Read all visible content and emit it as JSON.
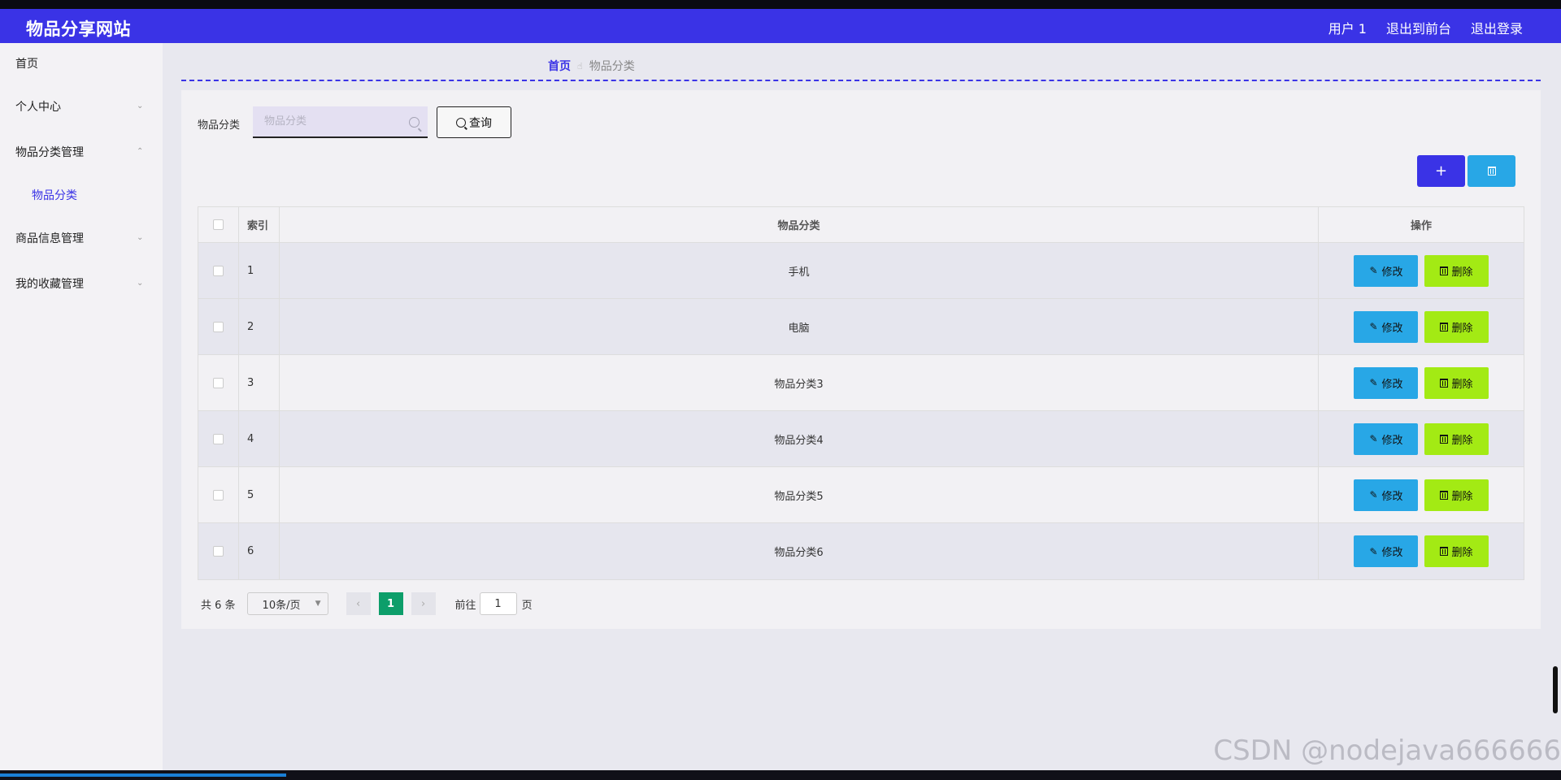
{
  "header": {
    "site_title": "物品分享网站",
    "user": "用户 1",
    "to_front": "退出到前台",
    "logout": "退出登录"
  },
  "sidebar": {
    "items": [
      {
        "label": "首页",
        "chevron": ""
      },
      {
        "label": "个人中心",
        "chevron": "chevron-down-icon"
      },
      {
        "label": "物品分类管理",
        "chevron": "chevron-up-icon"
      },
      {
        "label": "物品分类",
        "chevron": ""
      },
      {
        "label": "商品信息管理",
        "chevron": "chevron-down-icon"
      },
      {
        "label": "我的收藏管理",
        "chevron": "chevron-down-icon"
      }
    ]
  },
  "breadcrumb": {
    "home": "首页",
    "separator_icon": "hand-pointer-icon",
    "current": "物品分类"
  },
  "search": {
    "label": "物品分类",
    "placeholder": "物品分类",
    "value": "",
    "button_label": "查询"
  },
  "actions": {
    "add_label": "+",
    "delete_icon": "trash-icon"
  },
  "table": {
    "headers": {
      "index": "索引",
      "category": "物品分类",
      "operations": "操作"
    },
    "edit_label": "修改",
    "delete_label": "删除",
    "rows": [
      {
        "index": "1",
        "category": "手机"
      },
      {
        "index": "2",
        "category": "电脑"
      },
      {
        "index": "3",
        "category": "物品分类3"
      },
      {
        "index": "4",
        "category": "物品分类4"
      },
      {
        "index": "5",
        "category": "物品分类5"
      },
      {
        "index": "6",
        "category": "物品分类6"
      }
    ]
  },
  "pagination": {
    "total": "共 6 条",
    "page_size": "10条/页",
    "current_page": "1",
    "goto_prefix": "前往",
    "goto_value": "1",
    "goto_suffix": "页"
  },
  "watermark": "CSDN @nodejava666666",
  "colors": {
    "brand": "#3a33e6",
    "edit": "#28a7e6",
    "delete": "#a3ea14",
    "current_page": "#0d9e6a"
  }
}
